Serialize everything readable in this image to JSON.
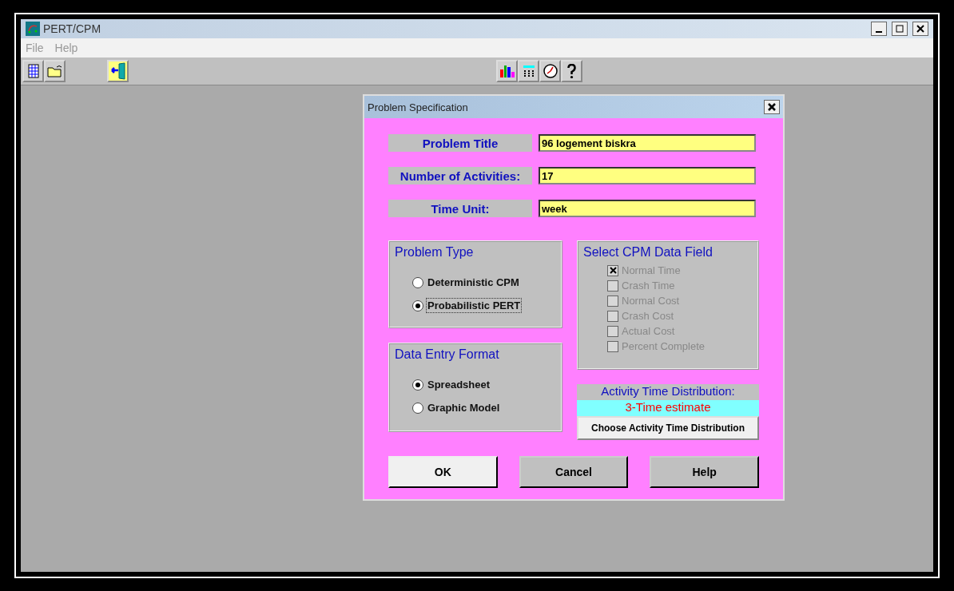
{
  "window": {
    "title": "PERT/CPM"
  },
  "menu": [
    "File",
    "Help"
  ],
  "toolbar_left": [
    {
      "kind": "new"
    },
    {
      "kind": "open"
    },
    {
      "kind": "exit"
    }
  ],
  "toolbar_center": [
    {
      "kind": "chart"
    },
    {
      "kind": "calculator"
    },
    {
      "kind": "clock"
    },
    {
      "kind": "help"
    }
  ],
  "dialog": {
    "title": "Problem Specification",
    "fields": [
      {
        "label": "Problem Title",
        "value": "96 logement biskra"
      },
      {
        "label": "Number of Activities:",
        "value": "17"
      },
      {
        "label": "Time Unit:",
        "value": "week"
      }
    ],
    "problem_type": {
      "title": "Problem Type",
      "options": [
        {
          "label": "Deterministic CPM",
          "selected": false,
          "focused": false
        },
        {
          "label": "Probabilistic PERT",
          "selected": true,
          "focused": true
        }
      ]
    },
    "data_entry_format": {
      "title": "Data Entry Format",
      "options": [
        {
          "label": "Spreadsheet",
          "selected": true,
          "focused": false
        },
        {
          "label": "Graphic Model",
          "selected": false,
          "focused": false
        }
      ]
    },
    "cpm_data_field": {
      "title": "Select CPM Data Field",
      "items": [
        {
          "label": "Normal Time",
          "checked": true,
          "disabled": true
        },
        {
          "label": "Crash Time",
          "checked": false,
          "disabled": true
        },
        {
          "label": "Normal Cost",
          "checked": false,
          "disabled": true
        },
        {
          "label": "Crash Cost",
          "checked": false,
          "disabled": true
        },
        {
          "label": "Actual Cost",
          "checked": false,
          "disabled": true
        },
        {
          "label": "Percent Complete",
          "checked": false,
          "disabled": true
        }
      ]
    },
    "distribution": {
      "label": "Activity Time Distribution:",
      "value": "3-Time estimate",
      "button": "Choose Activity Time Distribution"
    },
    "buttons": [
      {
        "label": "OK",
        "default": true
      },
      {
        "label": "Cancel",
        "default": false
      },
      {
        "label": "Help",
        "default": false
      }
    ]
  }
}
